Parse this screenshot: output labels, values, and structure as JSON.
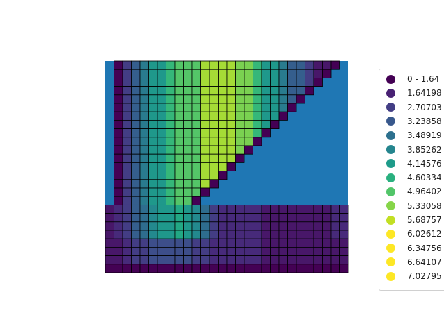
{
  "chart_data": {
    "type": "heatmap",
    "title": "",
    "xlabel": "",
    "ylabel": "",
    "axis": "off",
    "background_fill_color": "#1f77b4",
    "colormap": "viridis",
    "legend": {
      "placement": "right, outside plot",
      "entries": [
        {
          "label": "0 - 1.64",
          "color": "#440154"
        },
        {
          "label": "1.64198",
          "color": "#482173"
        },
        {
          "label": "2.70703",
          "color": "#433e85"
        },
        {
          "label": "3.23858",
          "color": "#38588c"
        },
        {
          "label": "3.48919",
          "color": "#2d708e"
        },
        {
          "label": "3.85262",
          "color": "#25858e"
        },
        {
          "label": "4.14576",
          "color": "#1e9b8a"
        },
        {
          "label": "4.60334",
          "color": "#2ab07f"
        },
        {
          "label": "4.96402",
          "color": "#52c569"
        },
        {
          "label": "5.33058",
          "color": "#86d549"
        },
        {
          "label": "5.68757",
          "color": "#c2df23"
        },
        {
          "label": "6.02612",
          "color": "#fde725"
        },
        {
          "label": "6.34756",
          "color": "#fde725"
        },
        {
          "label": "6.64107",
          "color": "#fde725"
        },
        {
          "label": "7.02795",
          "color": "#fde725"
        }
      ]
    },
    "grid_columns": 28,
    "grid_rows": 25,
    "column_class_ramp": {
      "upper": [
        0,
        3,
        5,
        7,
        9,
        11,
        12,
        12,
        14,
        14,
        14,
        13,
        11,
        9,
        7,
        5,
        3,
        1
      ],
      "lower_top_rows": [
        1,
        2,
        3,
        5,
        6,
        8,
        9,
        9,
        10,
        9,
        8,
        6,
        3,
        2,
        2,
        2,
        2,
        2,
        1,
        1,
        1,
        1,
        1,
        1,
        1,
        1,
        2,
        2
      ],
      "lower_bottom_rows": [
        1,
        1,
        2,
        3,
        3,
        4,
        4,
        4,
        4,
        4,
        3,
        3,
        2,
        2,
        2,
        2,
        2,
        2,
        1,
        1,
        1,
        1,
        1,
        1,
        1,
        1,
        1,
        1
      ]
    }
  }
}
